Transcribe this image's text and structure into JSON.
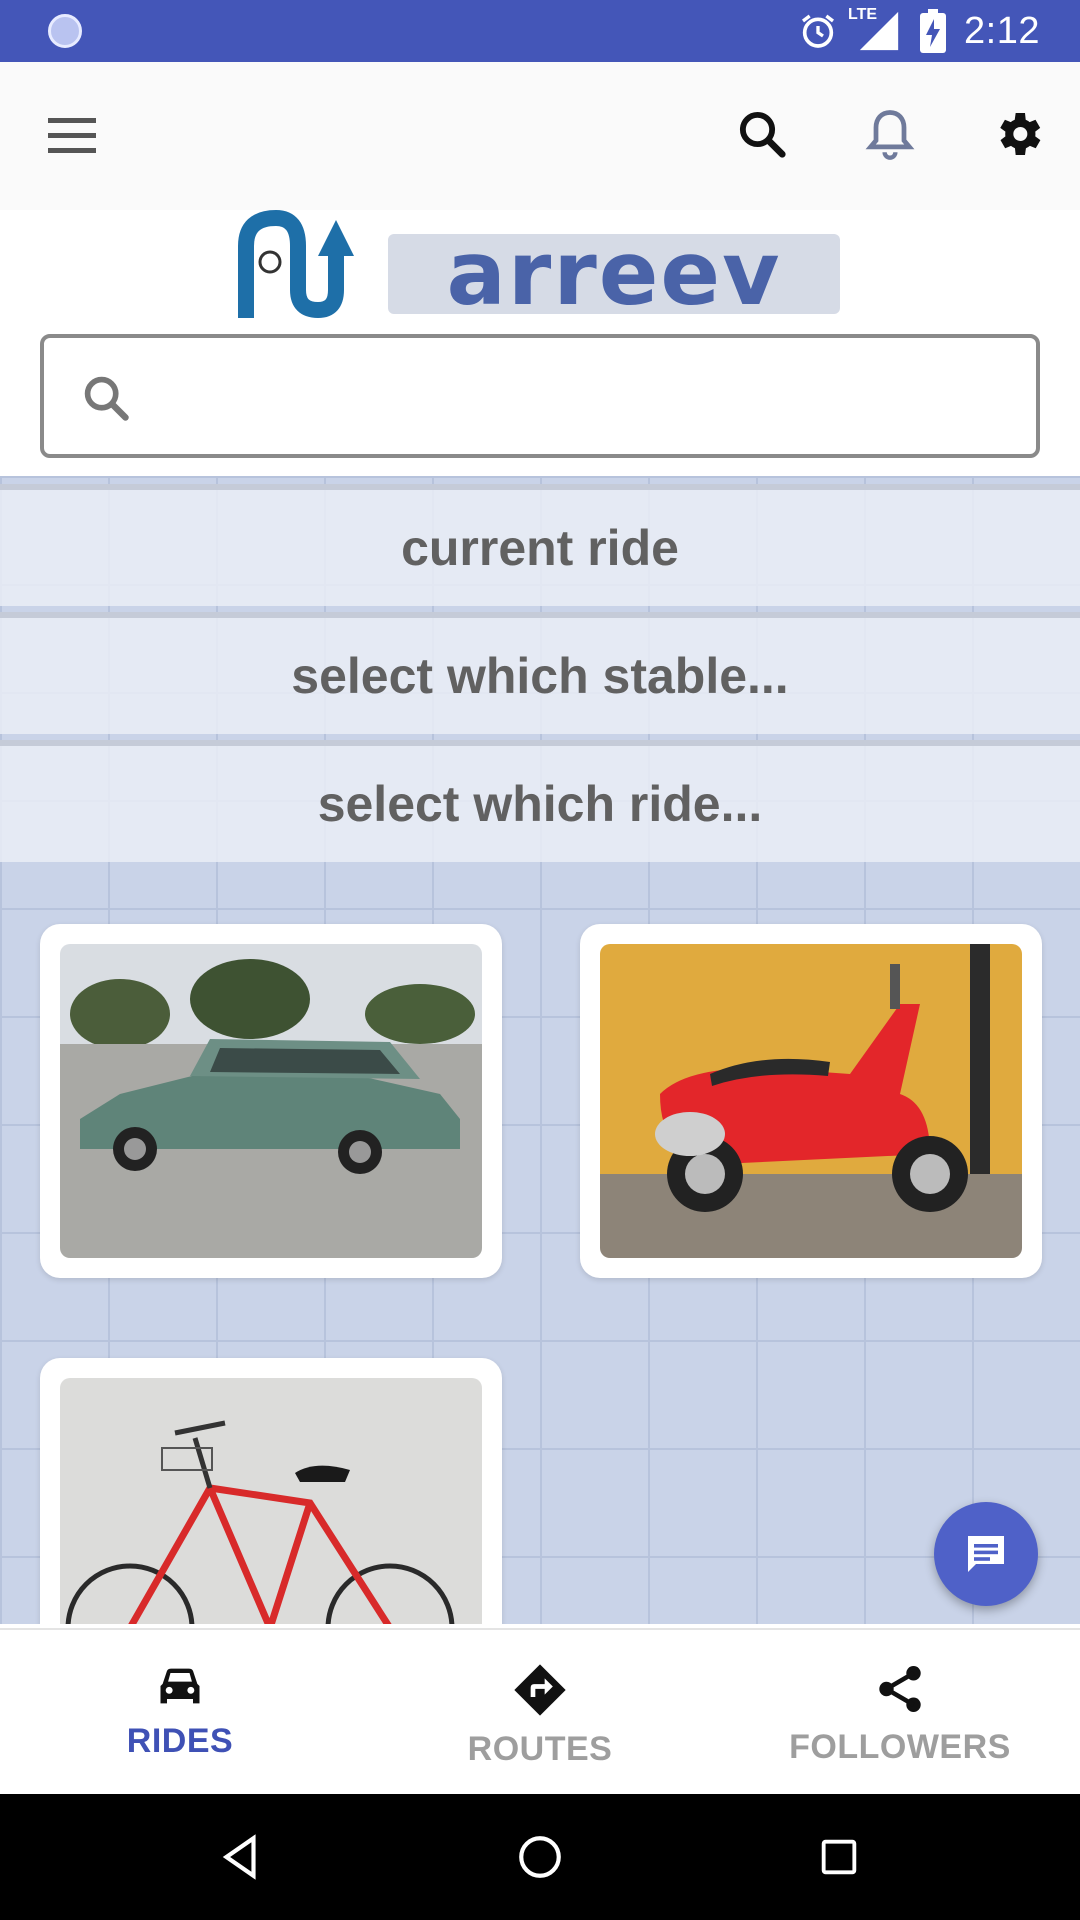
{
  "status_bar": {
    "time": "2:12",
    "network_label": "LTE",
    "icons": [
      "notification-dot-icon",
      "alarm-icon",
      "signal-icon",
      "battery-charging-icon"
    ]
  },
  "app_bar": {
    "icons": [
      "menu-icon",
      "search-icon",
      "bell-icon",
      "gear-icon"
    ]
  },
  "logo": {
    "text": "arreev",
    "accent": "#4a63a8",
    "brand": "#1e6fa8"
  },
  "search": {
    "value": "",
    "placeholder": ""
  },
  "options": [
    {
      "label": "current ride"
    },
    {
      "label": "select which stable..."
    },
    {
      "label": "select which ride..."
    }
  ],
  "rides": [
    {
      "name": "station-wagon",
      "image": "green-car-photo"
    },
    {
      "name": "scooter",
      "image": "red-scooter-photo"
    },
    {
      "name": "bicycle",
      "image": "red-bicycle-photo"
    }
  ],
  "fab": {
    "icon": "chat-icon"
  },
  "bottom_nav": {
    "items": [
      {
        "label": "RIDES",
        "icon": "car-icon",
        "active": true
      },
      {
        "label": "ROUTES",
        "icon": "directions-icon",
        "active": false
      },
      {
        "label": "FOLLOWERS",
        "icon": "share-icon",
        "active": false
      }
    ]
  },
  "system_nav": {
    "icons": [
      "back-icon",
      "home-icon",
      "recents-icon"
    ]
  },
  "colors": {
    "primary": "#3f51b5",
    "status_bar": "#4456b8",
    "inactive": "#9e9e9e"
  }
}
